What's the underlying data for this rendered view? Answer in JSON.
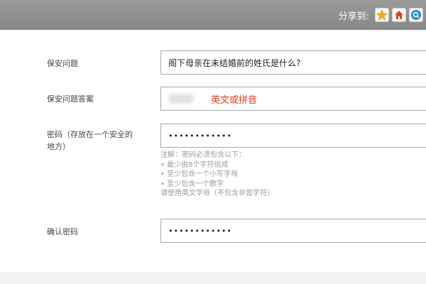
{
  "header": {
    "share_label": "分享到:",
    "share_buttons": [
      {
        "icon": "star-icon",
        "color": "#f2b200"
      },
      {
        "icon": "house-icon",
        "color": "#d44a1f"
      },
      {
        "icon": "search-circle-icon",
        "color": "#1f8ad4"
      }
    ]
  },
  "form": {
    "security_question": {
      "label": "保安问题",
      "value": "阁下母亲在未结婚前的姓氏是什么?"
    },
    "security_answer": {
      "label": "保安问题答案",
      "hint": "英文或拼音"
    },
    "password": {
      "label_line1": "密码（存放在一个安全的",
      "label_line2": "地方）",
      "value": "••••••••••••"
    },
    "password_notes": [
      "注解：密码必须包含以下：",
      "• 最少由8个字符组成",
      "• 至少包含一个小写字母",
      "• 至少包含一个数字",
      "请使用英文字母（不包含非音字符）"
    ],
    "confirm_password": {
      "label": "确认密码",
      "value": "••••••••••••"
    }
  },
  "colors": {
    "header_bar": "#8f8f8f",
    "hint_red": "#e03a1e",
    "note_gray": "#9a9a9a"
  }
}
